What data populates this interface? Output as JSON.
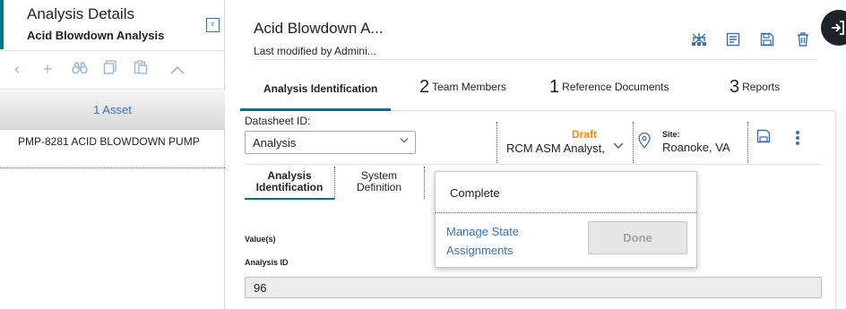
{
  "left_panel": {
    "title": "Analysis Details",
    "subtitle": "Acid Blowdown Analysis",
    "collapse_icon": "chevron-left-icon",
    "toolbar_icons": [
      "chevron-left-icon",
      "plus-icon",
      "binoculars-icon",
      "copy-icon",
      "paste-icon",
      "chevron-up-icon"
    ],
    "asset_count": "1 Asset",
    "assets": [
      "PMP-8281 ACID BLOWDOWN PUMP"
    ]
  },
  "header": {
    "title": "Acid Blowdown A...",
    "last_modified": "Last modified by Admini...",
    "icons": [
      "hierarchy-icon",
      "report-icon",
      "save-icon",
      "trash-icon"
    ],
    "side_button_icon": "exit-icon"
  },
  "tabs": [
    {
      "count": "",
      "label": "Analysis Identification",
      "active": true
    },
    {
      "count": "2",
      "label": "Team Members"
    },
    {
      "count": "1",
      "label": "Reference Documents"
    },
    {
      "count": "3",
      "label": "Reports"
    }
  ],
  "datasheet": {
    "label": "Datasheet ID:",
    "value": "Analysis"
  },
  "state": {
    "status": "Draft",
    "owner": "RCM ASM Analyst,",
    "status_color": "#f08a1a"
  },
  "site": {
    "label": "Site:",
    "value": "Roanoke, VA"
  },
  "subtabs": [
    {
      "label": "Analysis Identification",
      "active": true
    },
    {
      "label": "System Definition"
    }
  ],
  "form": {
    "values_label": "Value(s)",
    "analysis_id_label": "Analysis ID",
    "analysis_id_value": "96"
  },
  "popup": {
    "next_state": "Complete",
    "manage_link": "Manage State Assignments",
    "done_label": "Done"
  },
  "colors": {
    "accent": "#00758a",
    "link": "#3a6fb7"
  }
}
